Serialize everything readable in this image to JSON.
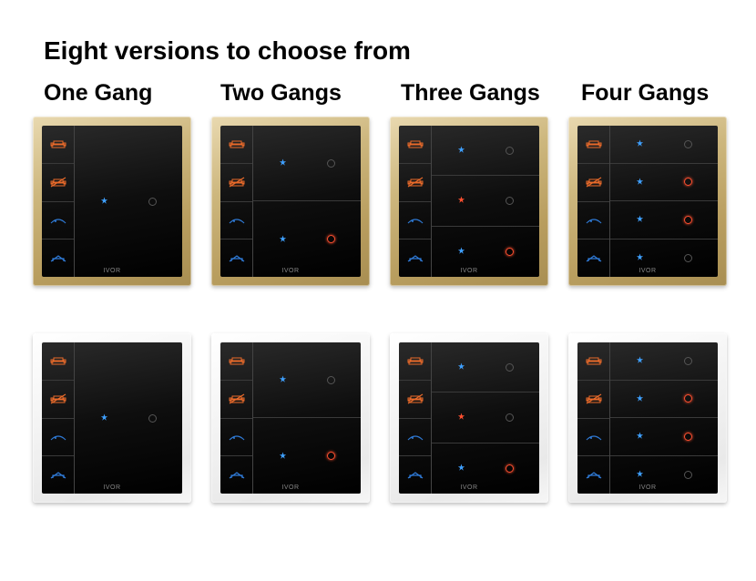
{
  "title": "Eight versions to choose from",
  "columns": [
    "One Gang",
    "Two Gangs",
    "Three Gangs",
    "Four Gangs"
  ],
  "brand": "IVOR",
  "frames": [
    "gold",
    "white"
  ],
  "scene_icons": [
    "sofa",
    "sofa-off",
    "sleep",
    "away"
  ],
  "gangs": [
    {
      "rows": [
        [
          {
            "led": "blue"
          },
          {
            "ring": "dim"
          }
        ]
      ]
    },
    {
      "rows": [
        [
          {
            "led": "blue"
          },
          {
            "ring": "dim"
          }
        ],
        [
          {
            "led": "blue"
          },
          {
            "ring": "red"
          }
        ]
      ]
    },
    {
      "rows": [
        [
          {
            "led": "blue"
          },
          {
            "ring": "dim"
          }
        ],
        [
          {
            "led": "red"
          },
          {
            "ring": "dim"
          }
        ],
        [
          {
            "led": "blue"
          },
          {
            "ring": "red"
          }
        ]
      ]
    },
    {
      "rows": [
        [
          {
            "led": "blue"
          },
          {
            "ring": "dim"
          }
        ],
        [
          {
            "led": "blue"
          },
          {
            "ring": "red"
          }
        ],
        [
          {
            "led": "blue"
          },
          {
            "ring": "red"
          }
        ],
        [
          {
            "led": "blue"
          },
          {
            "ring": "dim"
          }
        ]
      ]
    }
  ]
}
